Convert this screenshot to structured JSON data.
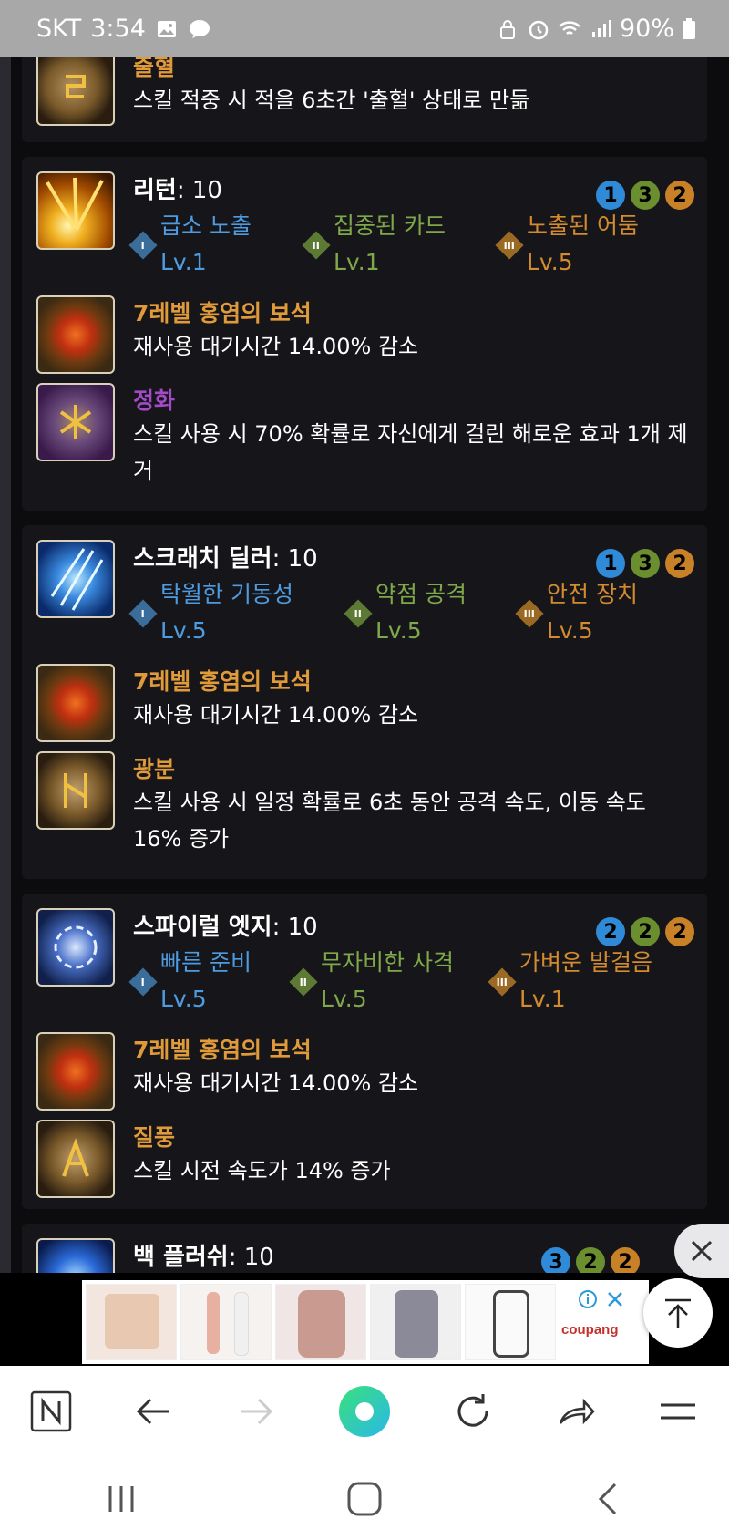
{
  "status_bar": {
    "carrier": "SKT",
    "time": "3:54",
    "battery": "90%"
  },
  "top_item": {
    "name": "출혈",
    "desc": "스킬 적중 시 적을 6초간 '출혈' 상태로 만듦"
  },
  "skills": [
    {
      "name": "리턴",
      "level": ": 10",
      "badges": [
        "1",
        "3",
        "2"
      ],
      "tripods": [
        {
          "numeral": "I",
          "name": "급소 노출",
          "lvl": "Lv.1"
        },
        {
          "numeral": "II",
          "name": "집중된 카드",
          "lvl": "Lv.1"
        },
        {
          "numeral": "III",
          "name": "노출된 어둠",
          "lvl": "Lv.5"
        }
      ],
      "gem": {
        "name": "7레벨 홍염의 보석",
        "desc": "재사용 대기시간 14.00% 감소"
      },
      "rune": {
        "name": "정화",
        "desc1": "스킬 사용 시 70% 확률로 자신에게 걸린 해로운 효과 1개 제",
        "desc2": "거"
      }
    },
    {
      "name": "스크래치 딜러",
      "level": ": 10",
      "badges": [
        "1",
        "3",
        "2"
      ],
      "tripods": [
        {
          "numeral": "I",
          "name": "탁월한 기동성",
          "lvl": "Lv.5"
        },
        {
          "numeral": "II",
          "name": "약점 공격",
          "lvl": "Lv.5"
        },
        {
          "numeral": "III",
          "name": "안전 장치",
          "lvl": "Lv.5"
        }
      ],
      "gem": {
        "name": "7레벨 홍염의 보석",
        "desc": "재사용 대기시간 14.00% 감소"
      },
      "rune": {
        "name": "광분",
        "desc1": "스킬 사용 시 일정 확률로 6초 동안 공격 속도, 이동 속도",
        "desc2": "16% 증가"
      }
    },
    {
      "name": "스파이럴 엣지",
      "level": ": 10",
      "badges": [
        "2",
        "2",
        "2"
      ],
      "tripods": [
        {
          "numeral": "I",
          "name": "빠른 준비",
          "lvl": "Lv.5"
        },
        {
          "numeral": "II",
          "name": "무자비한 사격",
          "lvl": "Lv.5"
        },
        {
          "numeral": "III",
          "name": "가벼운 발걸음",
          "lvl": "Lv.1"
        }
      ],
      "gem": {
        "name": "7레벨 홍염의 보석",
        "desc": "재사용 대기시간 14.00% 감소"
      },
      "rune": {
        "name": "질풍",
        "desc1": "스킬 시전 속도가 14% 증가",
        "desc2": ""
      }
    },
    {
      "name": "백 플러쉬",
      "level": ": 10",
      "badges": [
        "3",
        "2",
        "2"
      ]
    }
  ],
  "ad": {
    "brand": "coupang"
  },
  "colors": {
    "blue": "#4d9be0",
    "green": "#7fa84a",
    "orange": "#d48a2e",
    "purple": "#a24ac8"
  }
}
